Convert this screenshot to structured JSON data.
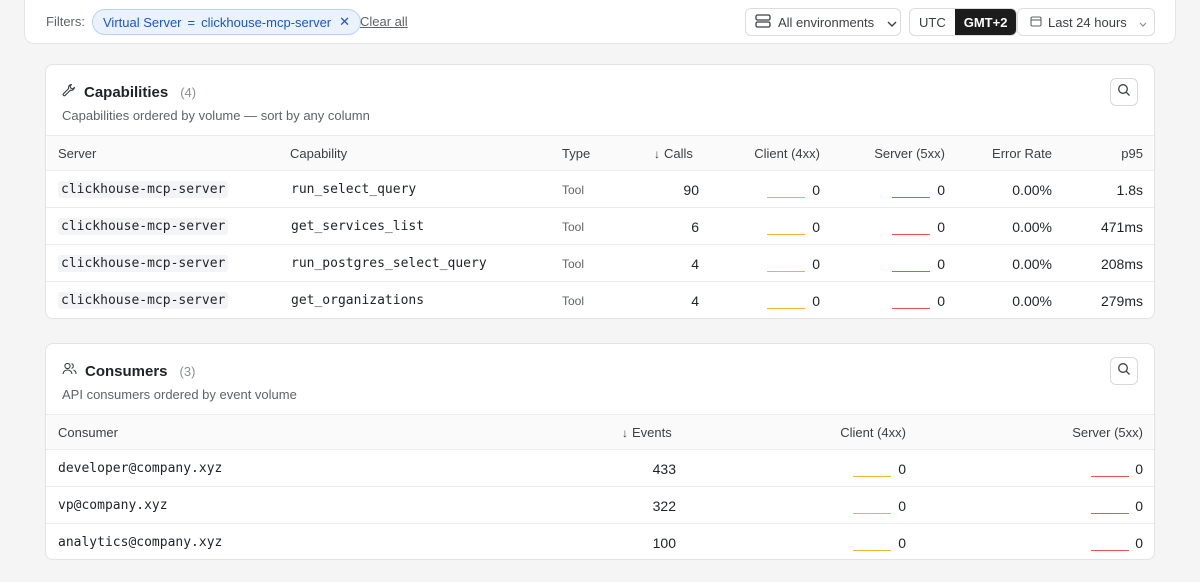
{
  "filters": {
    "label": "Filters:",
    "chip_key": "Virtual Server",
    "chip_op": "=",
    "chip_value": "clickhouse-mcp-server",
    "clear_label": "Clear all"
  },
  "environment": {
    "label": "All environments"
  },
  "timezone": {
    "options": [
      "UTC",
      "GMT+2"
    ],
    "selected": "GMT+2"
  },
  "time_range": {
    "label": "Last 24 hours"
  },
  "colors": {
    "client_4xx": "#f2b233",
    "server_5xx": "#ef5350",
    "chip_blue": "#1a56c9"
  },
  "capabilities": {
    "title": "Capabilities",
    "count": "(4)",
    "subtitle": "Capabilities ordered by volume — sort by any column",
    "columns": [
      "Server",
      "Capability",
      "Type",
      "Calls",
      "Client (4xx)",
      "Server (5xx)",
      "Error Rate",
      "p95"
    ],
    "rows": [
      {
        "server": "clickhouse-mcp-server",
        "capability": "run_select_query",
        "type": "Tool",
        "calls": "90",
        "client": "0",
        "server_err": "0",
        "error_rate": "0.00%",
        "p95": "1.8s"
      },
      {
        "server": "clickhouse-mcp-server",
        "capability": "get_services_list",
        "type": "Tool",
        "calls": "6",
        "client": "0",
        "server_err": "0",
        "error_rate": "0.00%",
        "p95": "471ms"
      },
      {
        "server": "clickhouse-mcp-server",
        "capability": "run_postgres_select_query",
        "type": "Tool",
        "calls": "4",
        "client": "0",
        "server_err": "0",
        "error_rate": "0.00%",
        "p95": "208ms"
      },
      {
        "server": "clickhouse-mcp-server",
        "capability": "get_organizations",
        "type": "Tool",
        "calls": "4",
        "client": "0",
        "server_err": "0",
        "error_rate": "0.00%",
        "p95": "279ms"
      }
    ]
  },
  "consumers": {
    "title": "Consumers",
    "count": "(3)",
    "subtitle": "API consumers ordered by event volume",
    "columns": [
      "Consumer",
      "Events",
      "Client (4xx)",
      "Server (5xx)"
    ],
    "rows": [
      {
        "consumer": "developer@company.xyz",
        "events": "433",
        "client": "0",
        "server_err": "0"
      },
      {
        "consumer": "vp@company.xyz",
        "events": "322",
        "client": "0",
        "server_err": "0"
      },
      {
        "consumer": "analytics@company.xyz",
        "events": "100",
        "client": "0",
        "server_err": "0"
      }
    ]
  },
  "icons": {
    "capabilities": "wrench-icon",
    "consumers": "users-icon",
    "search": "search-icon",
    "env": "server-stack-icon",
    "calendar": "calendar-icon",
    "close": "close-icon",
    "chevron": "chevron-down-icon",
    "sort": "arrow-down-icon"
  }
}
